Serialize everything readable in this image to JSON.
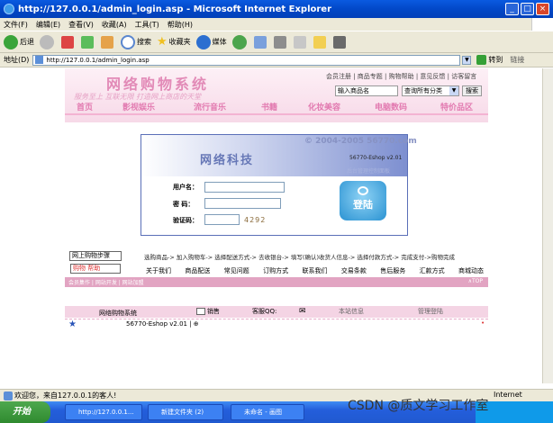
{
  "window": {
    "title": "http://127.0.0.1/admin_login.asp - Microsoft Internet Explorer"
  },
  "menu": [
    "文件(F)",
    "编辑(E)",
    "查看(V)",
    "收藏(A)",
    "工具(T)",
    "帮助(H)"
  ],
  "toolbar": {
    "back": "后退",
    "search": "搜索",
    "favorites": "收藏夹",
    "media": "媒体"
  },
  "address": {
    "label": "地址(D)",
    "url": "http://127.0.0.1/admin_login.asp",
    "go": "转到",
    "links": "链接"
  },
  "site": {
    "title": "网络购物系统",
    "slogan": "服务至上 互联无限  打造网上商店的天堂",
    "top_links": "会员注册 | 商品专题 | 购物帮助 | 意见反馈 | 访客留言",
    "search_placeholder": "输入商品名",
    "search_select": "查询所有分类",
    "search_button": "搜索",
    "nav": [
      "首页",
      "影视娱乐",
      "流行音乐",
      "书籍",
      "化妆美容",
      "电脑数码",
      "特价品区"
    ]
  },
  "login": {
    "copyright": "© 2004-2005  56770.com",
    "brand": "网络科技",
    "version": "56770-Eshop v2.01",
    "panel_title": "后台管理控制面板",
    "username_label": "用户名：",
    "password_label": "密  码：",
    "captcha_label": "验证码：",
    "captcha_value": "4292",
    "login_button": "登陆"
  },
  "steps": {
    "online_button": "网上购物步骤",
    "help_button": "购物  帮助",
    "text": "选购商品-> 加入购物车-> 选择配送方式-> 去收银台-> 填写(确认)收货人信息-> 选择付款方式-> 完成支付->购物完成"
  },
  "footer_nav": [
    "关于我们",
    "商品配送",
    "常见问题",
    "订购方式",
    "联系我们",
    "交易条款",
    "售后服务",
    "汇款方式",
    "商城动态"
  ],
  "pinkbar": {
    "left": "会员集作 | 网站开发 | 网站加盟",
    "right": "∧TOP"
  },
  "contact": {
    "sales": "销售",
    "kefu": "客服QQ:",
    "site_info": "本站信息",
    "admin_login": "管理登陆"
  },
  "bottom": {
    "system": "网络购物系统",
    "version": "56770-Eshop v2.01 | ⊕"
  },
  "status": {
    "text": "欢迎您，来自127.0.0.1的客人!",
    "zone": "Internet"
  },
  "taskbar": {
    "start": "开始",
    "tasks": [
      "http://127.0.0.1...",
      "新建文件夹 (2)",
      "未命名 - 画图"
    ]
  },
  "watermark": "CSDN @质文学习工作室",
  "colors": {
    "accent_pink": "#e28ab7",
    "nav_blue": "#6677b6",
    "xp_blue": "#245edb"
  }
}
